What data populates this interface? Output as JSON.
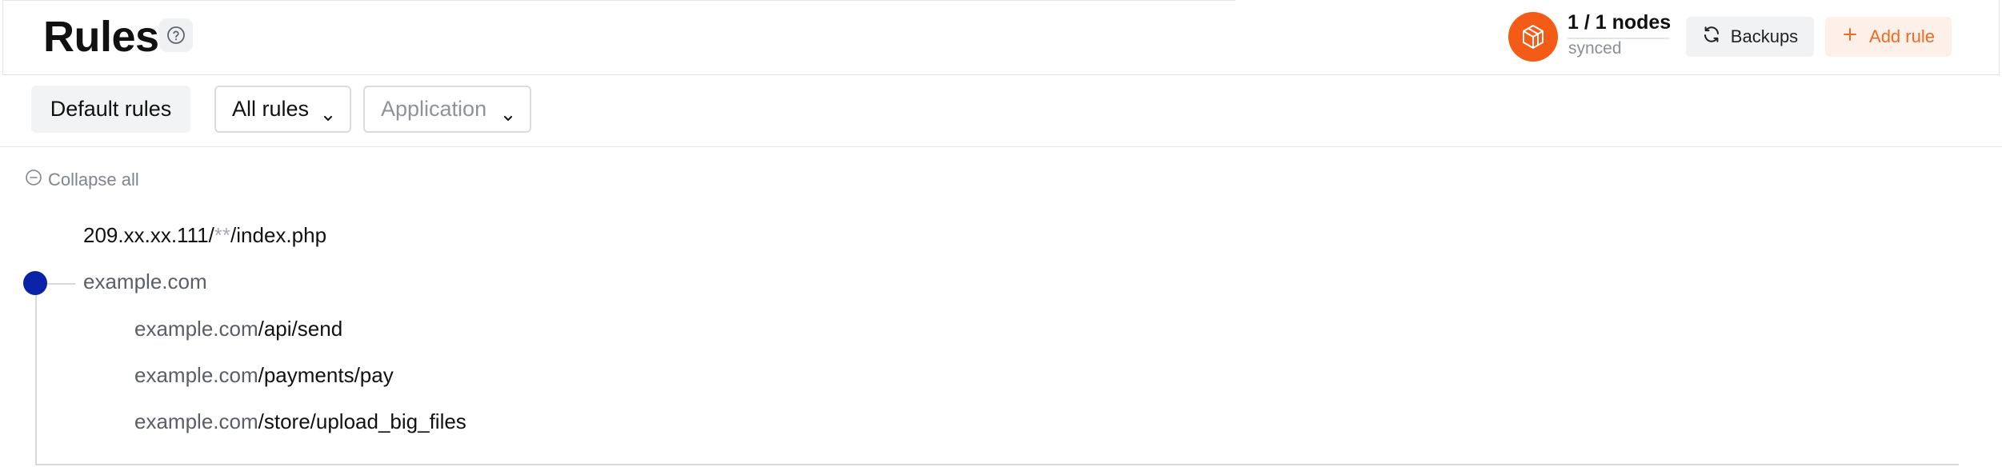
{
  "header": {
    "title": "Rules",
    "nodes_count": "1 / 1 nodes",
    "nodes_status": "synced",
    "backups_label": "Backups",
    "add_rule_label": "Add rule"
  },
  "icons": {
    "help": "question-circle-icon",
    "nodes": "node-cube-icon",
    "backups": "refresh-icon",
    "add": "plus-icon",
    "collapse": "minus-circle-icon",
    "dropdown": "chevron-down-icon"
  },
  "colors": {
    "accent_orange": "#f35b16",
    "add_text": "#f06a24",
    "tree_dot": "#0a22a8"
  },
  "filters": {
    "default_rules_label": "Default rules",
    "scope_value": "All rules",
    "application_placeholder": "Application"
  },
  "tree": {
    "collapse_label": "Collapse all",
    "rules": [
      {
        "host": "209.xx.xx.111/",
        "mask": "**",
        "path": "/index.php"
      },
      {
        "host": "example.com",
        "path": ""
      },
      {
        "host": "example.com",
        "path": "/api/send"
      },
      {
        "host": "example.com",
        "path": "/payments/pay"
      },
      {
        "host": "example.com",
        "path": "/store/upload_big_files"
      }
    ]
  }
}
